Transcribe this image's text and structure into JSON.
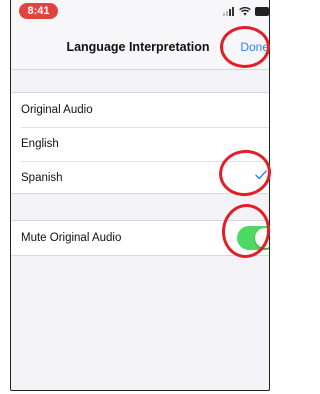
{
  "status_bar": {
    "time": "8:41",
    "signal_icon": "signal-icon",
    "wifi_icon": "wifi-icon",
    "battery_icon": "battery-icon"
  },
  "nav": {
    "title": "Language Interpretation",
    "done_label": "Done"
  },
  "audio_options": [
    {
      "label": "Original Audio",
      "selected": false
    },
    {
      "label": "English",
      "selected": false
    },
    {
      "label": "Spanish",
      "selected": true
    }
  ],
  "mute_original": {
    "label": "Mute Original Audio",
    "enabled": true
  },
  "colors": {
    "accent": "#2f7cf6",
    "toggle_on": "#4cd964",
    "annotation": "#e41e26",
    "time_pill": "#e0443c"
  }
}
